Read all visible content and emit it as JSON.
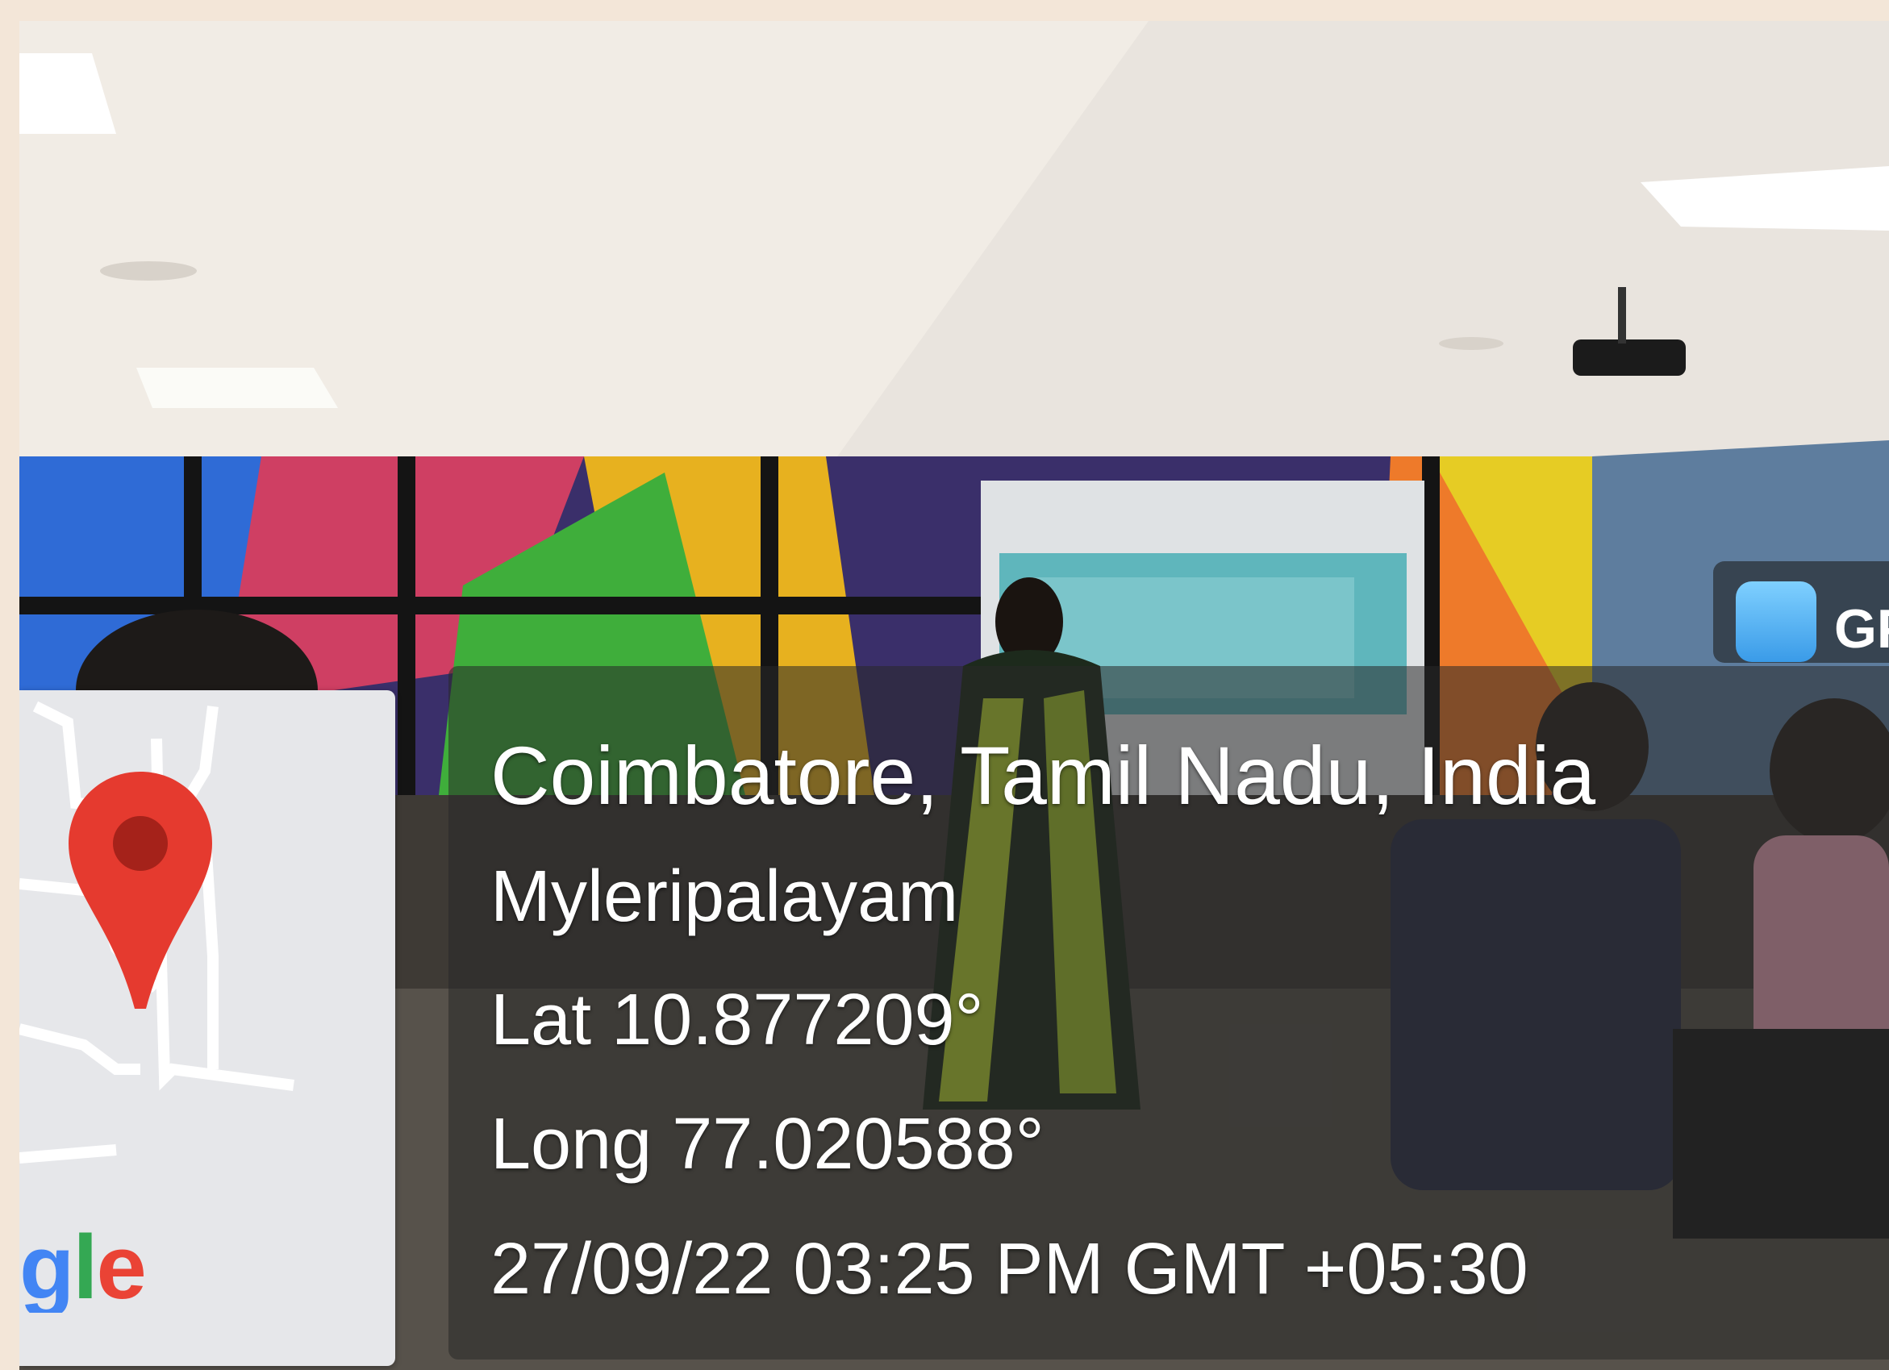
{
  "photo": {
    "description_icon": "gps-camera-photo",
    "location_title": "Coimbatore, Tamil Nadu, India",
    "area": "Myleripalayam",
    "latitude": "Lat 10.877209°",
    "longitude": "Long 77.020588°",
    "timestamp": "27/09/22 03:25 PM GMT +05:30"
  },
  "map": {
    "logo_text": "gle",
    "pin_icon": "map-pin-icon",
    "pin_color": "#e53a2f"
  },
  "app_badge": {
    "icon": "gps-camera-app-icon",
    "label": "GP"
  }
}
